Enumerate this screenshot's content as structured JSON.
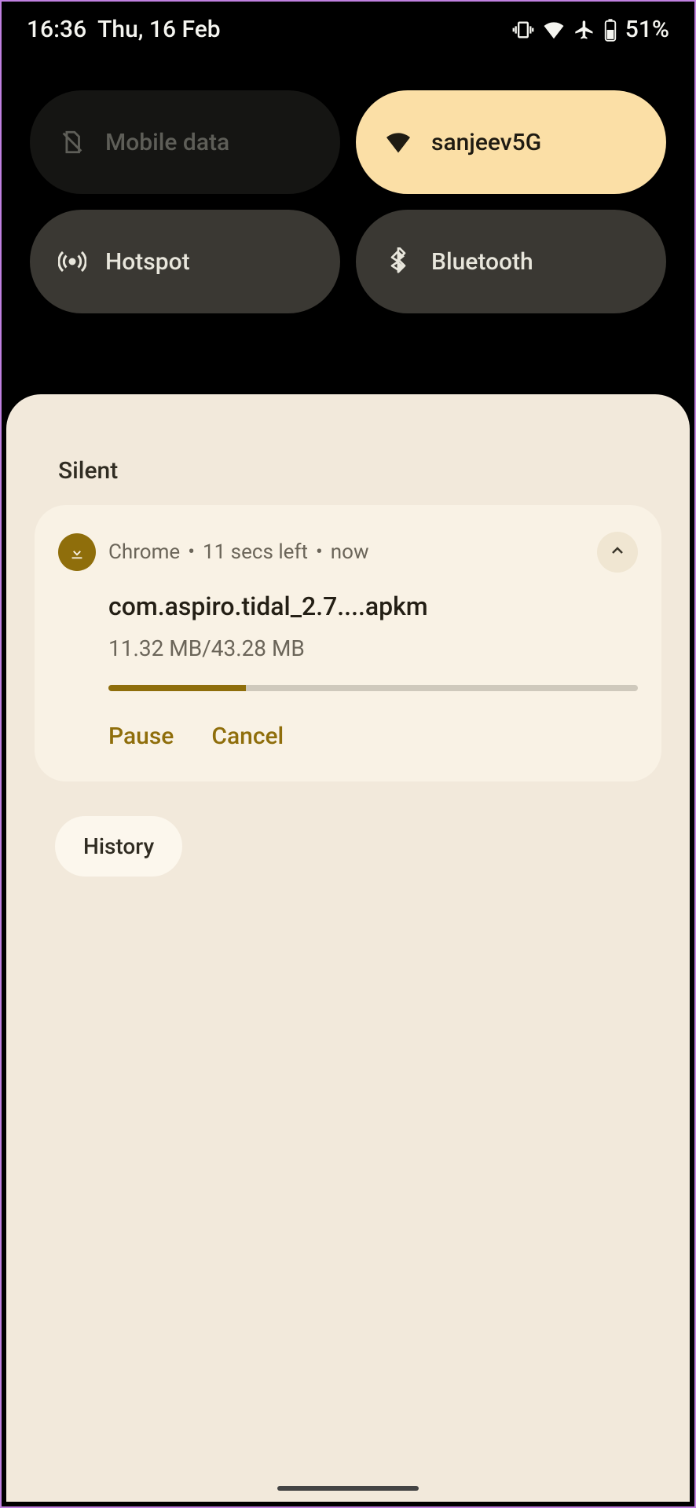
{
  "status_bar": {
    "time": "16:36",
    "date": "Thu, 16 Feb",
    "battery_pct": "51%",
    "icons": {
      "vibrate": "vibrate-icon",
      "wifi": "wifi-icon",
      "airplane": "airplane-icon",
      "battery": "battery-icon"
    }
  },
  "quick_settings": {
    "tiles": [
      {
        "id": "mobile-data",
        "label": "Mobile data",
        "icon": "no-sim-icon",
        "state": "disabled"
      },
      {
        "id": "wifi",
        "label": "sanjeev5G",
        "icon": "wifi-icon",
        "state": "on"
      },
      {
        "id": "hotspot",
        "label": "Hotspot",
        "icon": "hotspot-icon",
        "state": "off"
      },
      {
        "id": "bluetooth",
        "label": "Bluetooth",
        "icon": "bluetooth-icon",
        "state": "off"
      }
    ]
  },
  "notifications": {
    "section_label": "Silent",
    "download": {
      "app": "Chrome",
      "time_left": "11 secs left",
      "when": "now",
      "title": "com.aspiro.tidal_2.7....apkm",
      "progress_text": "11.32 MB/43.28 MB",
      "progress_pct": 26,
      "actions": {
        "pause": "Pause",
        "cancel": "Cancel"
      }
    },
    "history_label": "History"
  },
  "colors": {
    "accent_warm": "#fbdfa6",
    "accent_olive": "#8f6e0b",
    "shade_bg": "#f2e9db",
    "card_bg": "#f9f2e5"
  }
}
